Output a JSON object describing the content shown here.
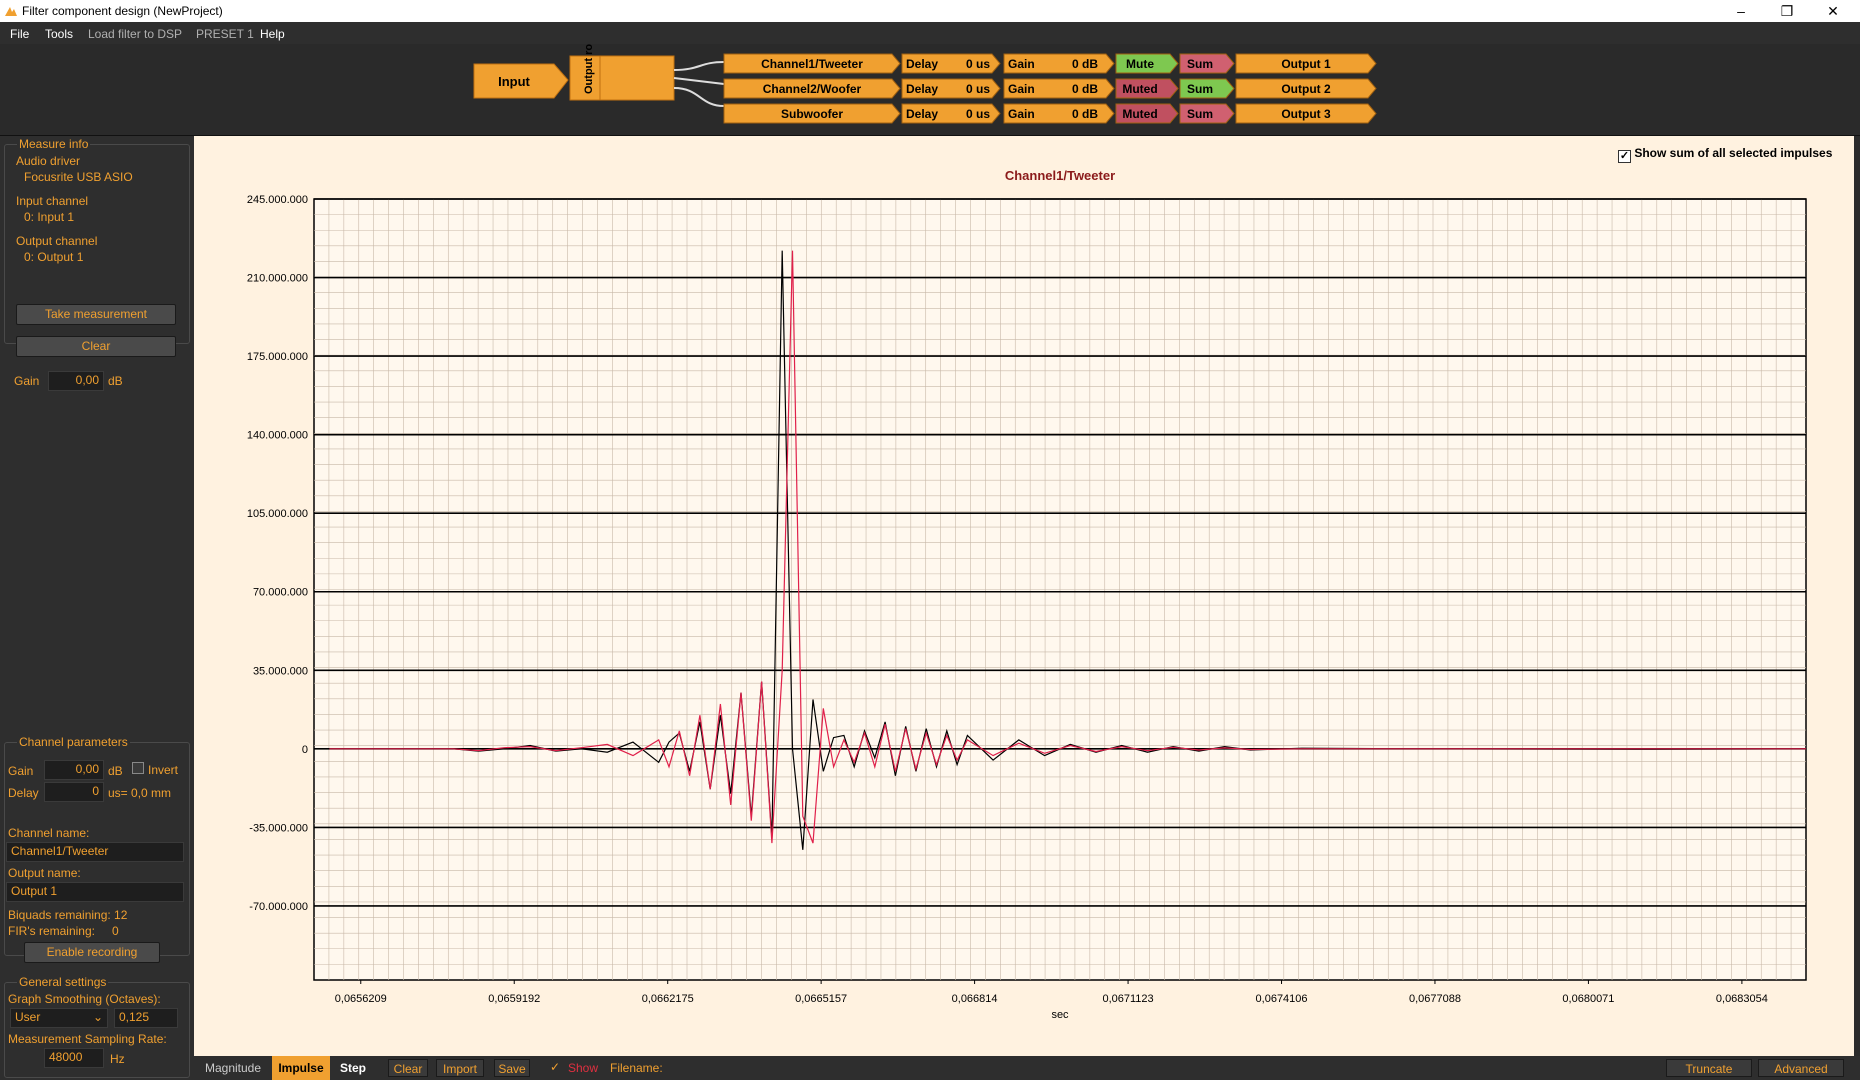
{
  "window": {
    "title": "Filter component design (NewProject)"
  },
  "menu": {
    "file": "File",
    "tools": "Tools",
    "load": "Load filter to DSP",
    "preset": "PRESET 1",
    "help": "Help"
  },
  "chain": {
    "input": "Input",
    "routing": "Output routing",
    "channels": [
      {
        "name": "Channel1/Tweeter",
        "delay_label": "Delay",
        "delay": "0 us",
        "gain_label": "Gain",
        "gain": "0 dB",
        "mute": "Mute",
        "sum": "Sum",
        "output": "Output 1",
        "mute_color": "#7ec850",
        "sum_color": "#d06070"
      },
      {
        "name": "Channel2/Woofer",
        "delay_label": "Delay",
        "delay": "0 us",
        "gain_label": "Gain",
        "gain": "0 dB",
        "mute": "Muted",
        "sum": "Sum",
        "output": "Output 2",
        "mute_color": "#c05060",
        "sum_color": "#7ec850"
      },
      {
        "name": "Subwoofer",
        "delay_label": "Delay",
        "delay": "0 us",
        "gain_label": "Gain",
        "gain": "0 dB",
        "mute": "Muted",
        "sum": "Sum",
        "output": "Output 3",
        "mute_color": "#c05060",
        "sum_color": "#d06070"
      }
    ]
  },
  "measure": {
    "title": "Measure info",
    "audio_driver_label": "Audio driver",
    "audio_driver": "Focusrite USB ASIO",
    "input_channel_label": "Input channel",
    "input_channel": "0: Input 1",
    "output_channel_label": "Output channel",
    "output_channel": "0: Output 1",
    "take_btn": "Take measurement",
    "clear_btn": "Clear",
    "gain_label": "Gain",
    "gain_value": "0,00",
    "gain_unit": "dB"
  },
  "channel_params": {
    "title": "Channel parameters",
    "gain_label": "Gain",
    "gain_value": "0,00",
    "gain_unit": "dB",
    "invert_label": "Invert",
    "delay_label": "Delay",
    "delay_value": "0",
    "delay_unit": "us= 0,0 mm",
    "channel_name_label": "Channel name:",
    "channel_name": "Channel1/Tweeter",
    "output_name_label": "Output name:",
    "output_name": "Output 1",
    "biquads": "Biquads remaining: 12",
    "firs_label": "FIR's remaining:",
    "firs_value": "0",
    "enable_recording": "Enable recording"
  },
  "general": {
    "title": "General settings",
    "smoothing_label": "Graph Smoothing (Octaves):",
    "smoothing_mode": "User",
    "smoothing_value": "0,125",
    "sampling_label": "Measurement Sampling Rate:",
    "sampling_value": "48000",
    "sampling_unit": "Hz"
  },
  "plot": {
    "show_sum_label": "Show sum of all selected impulses",
    "show_sum_checked": true
  },
  "bottom": {
    "tabs": [
      "Magnitude",
      "Impulse",
      "Step"
    ],
    "active_tab": "Impulse",
    "clear": "Clear",
    "import": "Import",
    "save": "Save",
    "show": "Show",
    "filename_label": "Filename:",
    "truncate": "Truncate",
    "advanced": "Advanced"
  },
  "chart_data": {
    "type": "line",
    "title": "Channel1/Tweeter",
    "xlabel": "sec",
    "ylabel": "",
    "x_ticks": [
      "0,0656209",
      "0,0659192",
      "0,0662175",
      "0,0665157",
      "0,066814",
      "0,0671123",
      "0,0674106",
      "0,0677088",
      "0,0680071",
      "0,0683054"
    ],
    "x_tick_values": [
      0.0656209,
      0.0659192,
      0.0662175,
      0.0665157,
      0.066814,
      0.0671123,
      0.0674106,
      0.0677088,
      0.0680071,
      0.0683054
    ],
    "y_ticks": [
      "245.000.000",
      "210.000.000",
      "175.000.000",
      "140.000.000",
      "105.000.000",
      "70.000.000",
      "35.000.000",
      "0",
      "-35.000.000",
      "-70.000.000"
    ],
    "y_tick_values": [
      245000000,
      210000000,
      175000000,
      140000000,
      105000000,
      70000000,
      35000000,
      0,
      -35000000,
      -70000000
    ],
    "xlim": [
      0.06553,
      0.06843
    ],
    "ylim": [
      -103000000,
      245000000
    ],
    "grid": true,
    "series": [
      {
        "color": "#000000",
        "x": [
          0.06556,
          0.06575,
          0.0658,
          0.06585,
          0.0659,
          0.06595,
          0.066,
          0.06605,
          0.0661,
          0.06615,
          0.0662,
          0.06622,
          0.06624,
          0.06626,
          0.06628,
          0.0663,
          0.06632,
          0.06634,
          0.06636,
          0.06638,
          0.0664,
          0.06642,
          0.06644,
          0.06646,
          0.06648,
          0.0665,
          0.06652,
          0.06654,
          0.06656,
          0.06658,
          0.0666,
          0.06662,
          0.06664,
          0.06666,
          0.06668,
          0.0667,
          0.06672,
          0.06674,
          0.06676,
          0.06678,
          0.0668,
          0.06685,
          0.0669,
          0.06695,
          0.067,
          0.06705,
          0.0671,
          0.06715,
          0.0672,
          0.06725,
          0.0673,
          0.06735,
          0.06745,
          0.06765,
          0.0681,
          0.06843
        ],
        "y": [
          0,
          0,
          0,
          -1000000,
          0,
          1500000,
          -1000000,
          0,
          -1500000,
          3000000,
          -6000000,
          3000000,
          7000000,
          -10000000,
          12000000,
          -18000000,
          15000000,
          -20000000,
          25000000,
          -30000000,
          30000000,
          -40000000,
          222000000,
          0,
          -45000000,
          22000000,
          -10000000,
          5000000,
          6000000,
          -8000000,
          8000000,
          -4000000,
          12000000,
          -12000000,
          10000000,
          -10000000,
          9000000,
          -8000000,
          8000000,
          -7000000,
          6000000,
          -5000000,
          4000000,
          -3000000,
          2000000,
          -1500000,
          1500000,
          -1500000,
          1000000,
          -1000000,
          1000000,
          -500000,
          300000,
          0,
          -200000,
          0
        ]
      },
      {
        "color": "#e0204a",
        "x": [
          0.06556,
          0.06575,
          0.0658,
          0.06585,
          0.0659,
          0.06595,
          0.066,
          0.06605,
          0.0661,
          0.06615,
          0.0662,
          0.06622,
          0.06624,
          0.06626,
          0.06628,
          0.0663,
          0.06632,
          0.06634,
          0.06636,
          0.06638,
          0.0664,
          0.06642,
          0.06644,
          0.06646,
          0.06648,
          0.0665,
          0.06652,
          0.06654,
          0.06656,
          0.06658,
          0.0666,
          0.06662,
          0.06664,
          0.06666,
          0.06668,
          0.0667,
          0.06672,
          0.06674,
          0.06676,
          0.06678,
          0.0668,
          0.06685,
          0.0669,
          0.06695,
          0.067,
          0.06705,
          0.0671,
          0.06715,
          0.0672,
          0.06725,
          0.0673,
          0.06735,
          0.06745,
          0.06765,
          0.0681,
          0.06843
        ],
        "y": [
          0,
          0,
          0,
          -800000,
          500000,
          1000000,
          -800000,
          500000,
          2000000,
          -3000000,
          4000000,
          -8000000,
          8000000,
          -12000000,
          15000000,
          -18000000,
          20000000,
          -25000000,
          25000000,
          -32000000,
          30000000,
          -42000000,
          35000000,
          222000000,
          -30000000,
          -42000000,
          18000000,
          -8000000,
          4000000,
          -6000000,
          7000000,
          -8000000,
          11000000,
          -10000000,
          9000000,
          -9000000,
          7000000,
          -7000000,
          6000000,
          -5000000,
          4000000,
          -3000000,
          2500000,
          -2000000,
          1500000,
          -1200000,
          1000000,
          -800000,
          700000,
          -500000,
          400000,
          -300000,
          0,
          0,
          0,
          0
        ]
      }
    ]
  }
}
